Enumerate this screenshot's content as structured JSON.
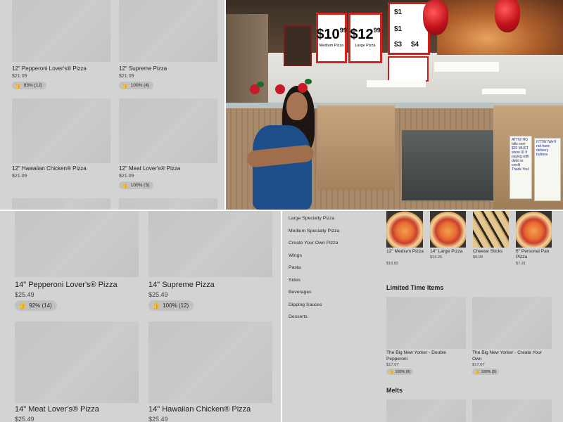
{
  "top_left": {
    "items": [
      {
        "name": "12\" Pepperoni Lover's® Pizza",
        "price": "$21.09",
        "rating": "83% (12)"
      },
      {
        "name": "12\" Supreme Pizza",
        "price": "$21.09",
        "rating": "100% (4)"
      },
      {
        "name": "12\" Hawaiian Chicken® Pizza",
        "price": "$21.09",
        "rating": ""
      },
      {
        "name": "12\" Meat Lover's® Pizza",
        "price": "$21.09",
        "rating": "100% (3)"
      }
    ]
  },
  "photo": {
    "menu_boards": [
      {
        "price_whole": "$10",
        "price_cents": "99",
        "caption": "Medium Pizza"
      },
      {
        "price_whole": "$12",
        "price_cents": "99",
        "caption": "Large Pizza"
      }
    ],
    "promo_prices": [
      "$1",
      "$1",
      "$3",
      "$4"
    ],
    "sign_right": "HTTW! We'll not have delivery buttons",
    "sign_left": "ATTN! HO bills over $20 MUST show ID if paying with debit or credit Thank You!"
  },
  "bottom_left": {
    "items": [
      {
        "name": "14\" Pepperoni Lover's® Pizza",
        "price": "$25.49",
        "rating": "92% (14)"
      },
      {
        "name": "14\" Supreme Pizza",
        "price": "$25.49",
        "rating": "100% (12)"
      },
      {
        "name": "14\" Meat Lover's® Pizza",
        "price": "$25.49",
        "rating": ""
      },
      {
        "name": "14\" Hawaiian Chicken® Pizza",
        "price": "$25.49",
        "rating": ""
      }
    ]
  },
  "menu": {
    "categories": [
      "Large Specialty Pizza",
      "Medium Specialty Pizza",
      "Create Your Own Pizza",
      "Wings",
      "Pasta",
      "Sides",
      "Beverages",
      "Dipping Sauces",
      "Desserts"
    ],
    "top_items": [
      {
        "name": "12\" Medium Pizza",
        "price": "$16.82"
      },
      {
        "name": "14\" Large Pizza",
        "price": "$19.26"
      },
      {
        "name": "Cheese Sticks",
        "price": "$9.99"
      },
      {
        "name": "6\" Personal Pan Pizza",
        "price": "$7.31"
      }
    ],
    "limited_title": "Limited Time Items",
    "limited_items": [
      {
        "name": "The Big New Yorker - Double Pepperoni",
        "price": "$17.07",
        "rating": "100% (6)"
      },
      {
        "name": "The Big New Yorker - Create Your Own",
        "price": "$17.07",
        "rating": "100% (5)"
      }
    ],
    "melts_title": "Melts"
  },
  "icons": {
    "rating": "thumbs-up-icon"
  },
  "colors": {
    "background": "#d3d3d3",
    "thumb": "#c7c7c7",
    "divider": "#ffffff",
    "brand_red": "#c9201b"
  }
}
